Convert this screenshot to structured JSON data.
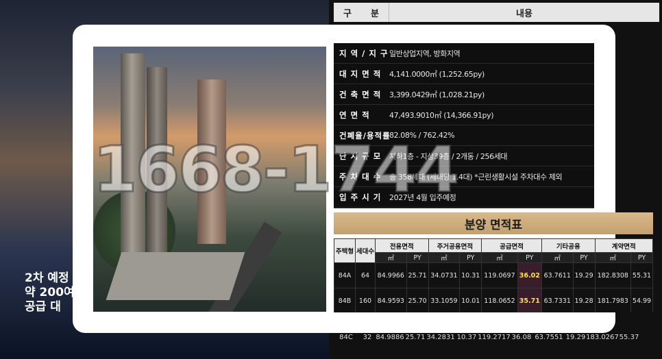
{
  "background": {
    "header_col1_a": "구",
    "header_col1_b": "분",
    "header_col2": "내용",
    "left_text_lines": [
      "2차 예정",
      "약 200여",
      "공급 대"
    ],
    "behind_row": [
      "84C",
      "32",
      "84.9886",
      "25.71",
      "34.2831",
      "10.37",
      "119.2717",
      "36.08",
      "63.7551",
      "19.29",
      "183.0267",
      "55.37"
    ]
  },
  "info": {
    "rows": [
      {
        "label": "지 역 / 지 구",
        "value": "일반상업지역, 방화지역"
      },
      {
        "label": "대 지 면 적",
        "value": "4,141.0000㎡ (1,252.65py)"
      },
      {
        "label": "건 축 면 적",
        "value": "3,399.0429㎡ (1,028.21py)"
      },
      {
        "label": "연   면   적",
        "value": "47,493.9010㎡ (14,366.91py)"
      },
      {
        "label": "건폐율/용적률",
        "value": "82.08% / 762.42%"
      },
      {
        "label": "단 지 규 모",
        "value": "지하1층 - 지상39층 / 2개동 / 256세대"
      },
      {
        "label": "주 차 대 수",
        "value": "총 358세대 (세대당 1.4대) *근린생활시설 주차대수 제외"
      },
      {
        "label": "입 주 시 기",
        "value": "2027년 4월 입주예정"
      }
    ]
  },
  "area": {
    "title": "분양 면적표",
    "headers": {
      "type": "주택형",
      "units": "세대수",
      "exclusive": "전용면적",
      "residential_common": "주거공용면적",
      "supply": "공급면적",
      "other_common": "기타공용",
      "contract": "계약면적",
      "sqm": "㎡",
      "py": "PY"
    },
    "rows": [
      [
        "84A",
        "64",
        "84.9966",
        "25.71",
        "34.0731",
        "10.31",
        "119.0697",
        "36.02",
        "63.7611",
        "19.29",
        "182.8308",
        "55.31"
      ],
      [
        "84B",
        "160",
        "84.9593",
        "25.70",
        "33.1059",
        "10.01",
        "118.0652",
        "35.71",
        "63.7331",
        "19.28",
        "181.7983",
        "54.99"
      ]
    ]
  },
  "overlay": {
    "phone": "1668-1744"
  }
}
